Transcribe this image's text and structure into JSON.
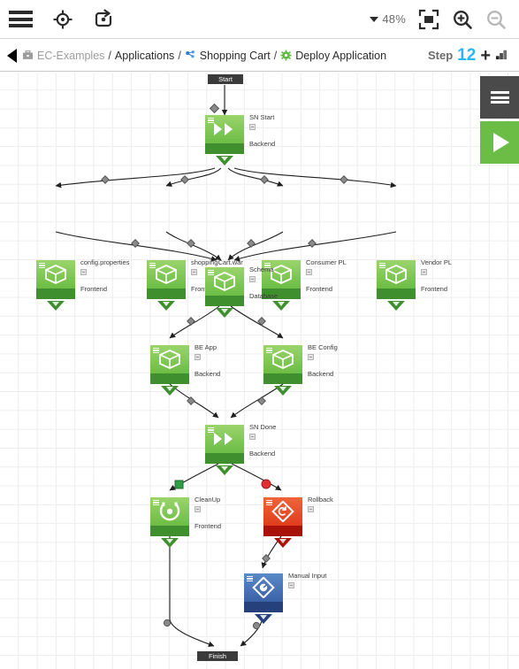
{
  "toolbar": {
    "menu_icon": "hamburger-menu-icon",
    "locate_icon": "crosshair-target-icon",
    "rerun_icon": "refresh-rotate-icon",
    "zoom_level": "48%",
    "fit_icon": "fit-to-screen-icon",
    "zoom_in_icon": "zoom-in-icon",
    "zoom_out_icon": "zoom-out-icon"
  },
  "breadcrumb": {
    "back_label": "◀",
    "items": [
      {
        "label": "EC-Examples",
        "icon": "briefcase-icon",
        "muted": true
      },
      {
        "label": "Applications",
        "icon": "",
        "muted": false
      },
      {
        "label": "Shopping Cart",
        "icon": "application-icon",
        "muted": false
      },
      {
        "label": "Deploy Application",
        "icon": "gear-icon",
        "muted": false
      }
    ],
    "separator": "/",
    "step_label": "Step",
    "step_number": "12",
    "add_label": "+",
    "add_icon": "add-step-icon"
  },
  "side_panel": {
    "menu_icon": "hamburger-menu-icon",
    "run_icon": "run-play-icon"
  },
  "graph": {
    "start_label": "Start",
    "finish_label": "Finish",
    "nodes": [
      {
        "id": "sn-start",
        "title": "SN Start",
        "subtitle": "Backend",
        "color": "green",
        "glyph": "chevrons-icon"
      },
      {
        "id": "config-props",
        "title": "config.properties",
        "subtitle": "Frontend",
        "color": "green",
        "glyph": "cube-icon"
      },
      {
        "id": "shoppingcart",
        "title": "shoppingCart.war",
        "subtitle": "Frontend",
        "color": "green",
        "glyph": "cube-icon"
      },
      {
        "id": "consumer-pl",
        "title": "Consumer PL",
        "subtitle": "Frontend",
        "color": "green",
        "glyph": "cube-icon"
      },
      {
        "id": "vendor-pl",
        "title": "Vendor PL",
        "subtitle": "Frontend",
        "color": "green",
        "glyph": "cube-icon"
      },
      {
        "id": "schema",
        "title": "Schema",
        "subtitle": "Database",
        "color": "green",
        "glyph": "cube-icon"
      },
      {
        "id": "be-app",
        "title": "BE App",
        "subtitle": "Backend",
        "color": "green",
        "glyph": "cube-icon"
      },
      {
        "id": "be-config",
        "title": "BE Config",
        "subtitle": "Backend",
        "color": "green",
        "glyph": "cube-icon"
      },
      {
        "id": "sn-done",
        "title": "SN Done",
        "subtitle": "Backend",
        "color": "green",
        "glyph": "chevrons-icon"
      },
      {
        "id": "cleanup",
        "title": "CleanUp",
        "subtitle": "Frontend",
        "color": "green",
        "glyph": "gear-target-icon"
      },
      {
        "id": "rollback",
        "title": "Rollback",
        "subtitle": "",
        "color": "red",
        "glyph": "rollback-diamond-icon"
      },
      {
        "id": "manual-input",
        "title": "Manual Input",
        "subtitle": "",
        "color": "blue",
        "glyph": "manual-diamond-icon"
      }
    ],
    "colors": {
      "green_top": "#7ec85a",
      "green_bottom": "#3f8f2e",
      "red_top": "#e54a28",
      "red_bottom": "#a81208",
      "blue_top": "#4574b6",
      "blue_bottom": "#26407c",
      "terminal": "#3b3b3b",
      "accent_step": "#29b6f6",
      "success_connector": "#2f9e44",
      "error_connector": "#e03131"
    }
  }
}
